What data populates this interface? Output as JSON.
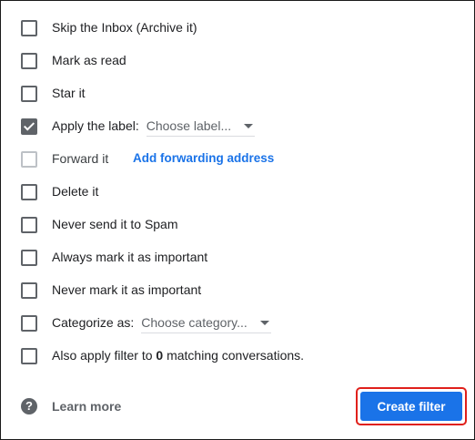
{
  "options": [
    {
      "label": "Skip the Inbox (Archive it)",
      "checked": false
    },
    {
      "label": "Mark as read",
      "checked": false
    },
    {
      "label": "Star it",
      "checked": false
    },
    {
      "label": "Apply the label:",
      "checked": true,
      "select": "Choose label..."
    },
    {
      "label": "Forward it",
      "checked": false,
      "disabled": true,
      "link": "Add forwarding address"
    },
    {
      "label": "Delete it",
      "checked": false
    },
    {
      "label": "Never send it to Spam",
      "checked": false
    },
    {
      "label": "Always mark it as important",
      "checked": false
    },
    {
      "label": "Never mark it as important",
      "checked": false
    },
    {
      "label": "Categorize as:",
      "checked": false,
      "select": "Choose category..."
    }
  ],
  "also_apply": {
    "prefix": "Also apply filter to",
    "count": "0",
    "suffix": "matching conversations.",
    "checked": false
  },
  "footer": {
    "help_icon": "help-icon",
    "learn_more": "Learn more",
    "create_filter": "Create filter"
  },
  "colors": {
    "primary": "#1a73e8",
    "highlight_border": "#e0201b",
    "checkbox": "#5f6368"
  }
}
